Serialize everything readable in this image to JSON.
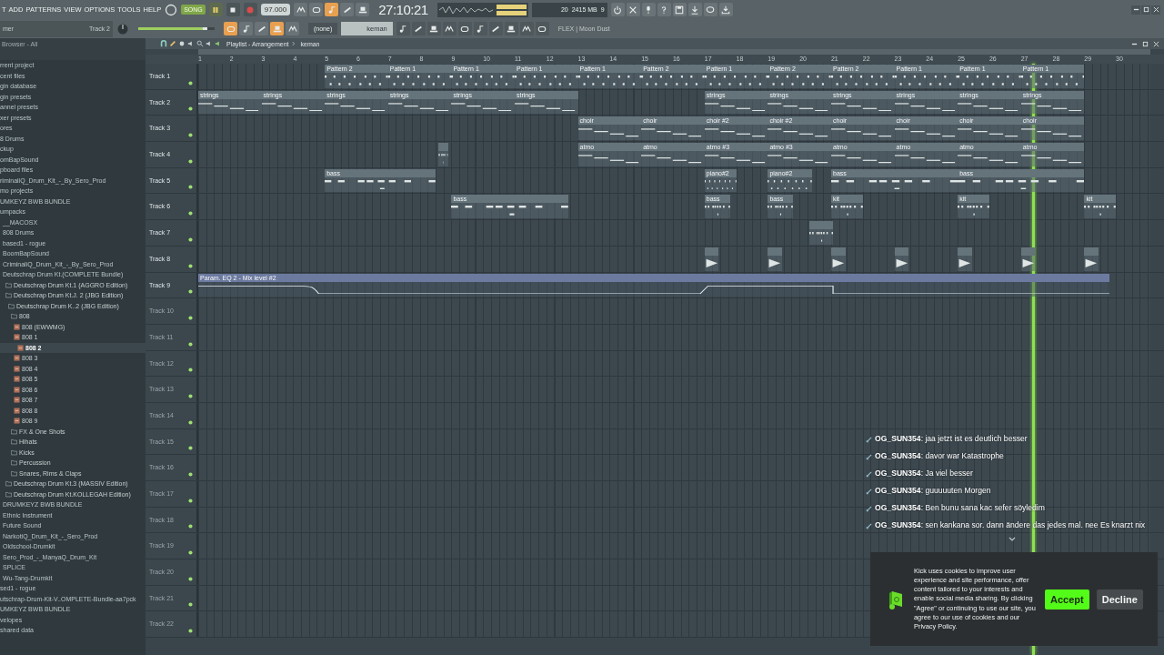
{
  "menu": [
    "T",
    "ADD",
    "PATTERNS",
    "VIEW",
    "OPTIONS",
    "TOOLS",
    "HELP"
  ],
  "hint_panel": {
    "title": "mer",
    "value": "Track 2"
  },
  "transport": {
    "song_mode": {
      "label": "SONG",
      "on": true
    },
    "tempo": "97.000",
    "time": "27:10:21",
    "memory": "2415 MB",
    "voices": "9",
    "cpu": "20"
  },
  "tool_buttons": [
    {
      "on": false
    },
    {
      "on": false
    },
    {
      "on": true
    },
    {
      "on": false
    },
    {
      "on": false
    }
  ],
  "master_volume": {
    "level": 0.9
  },
  "snap_buttons": [
    {
      "on": true
    },
    {
      "on": false
    },
    {
      "on": false
    },
    {
      "on": true
    },
    {
      "on": false
    }
  ],
  "channel_dropdown": "(none)",
  "pattern_selector": "keman",
  "hint_text": "FLEX | Moon Dust",
  "browser": {
    "title": "Browser - All",
    "items": [
      {
        "label": "rrent project",
        "kind": "category",
        "selected": false
      },
      {
        "label": "cent files",
        "kind": "category",
        "selected": false
      },
      {
        "label": "gin database",
        "kind": "category",
        "selected": false
      },
      {
        "label": "gin presets",
        "kind": "category",
        "selected": false
      },
      {
        "label": "annel presets",
        "kind": "category",
        "selected": false
      },
      {
        "label": "xer presets",
        "kind": "category",
        "selected": false
      },
      {
        "label": "ores",
        "kind": "category",
        "selected": false
      },
      {
        "label": "8 Drums",
        "kind": "category",
        "selected": false
      },
      {
        "label": "ckup",
        "kind": "category",
        "selected": false
      },
      {
        "label": "omBapSound",
        "kind": "category",
        "selected": false
      },
      {
        "label": "pboard files",
        "kind": "category",
        "selected": false
      },
      {
        "label": "riminaliQ_Drum_Kit_-_By_Sero_Prod",
        "kind": "category",
        "selected": false
      },
      {
        "label": "mo projects",
        "kind": "category",
        "selected": false
      },
      {
        "label": "UMKEYZ BWB BUNDLE",
        "kind": "category",
        "selected": false
      },
      {
        "label": "umpacks",
        "kind": "category",
        "selected": false,
        "children": [
          {
            "label": "__MACOSX",
            "kind": "category",
            "selected": false
          },
          {
            "label": "808 Drums",
            "kind": "category",
            "selected": false
          },
          {
            "label": "based1 - rogue",
            "kind": "category",
            "selected": false
          },
          {
            "label": "BoomBapSound",
            "kind": "category",
            "selected": false
          },
          {
            "label": "CriminaliQ_Drum_Kit_-_By_Sero_Prod",
            "kind": "category",
            "selected": false
          },
          {
            "label": "Deutschrap Drum Kt.(COMPLETE Bundle)",
            "kind": "category",
            "selected": false,
            "children": [
              {
                "label": "Deutschrap Drum Kt.1 (AGGRO Edition)",
                "kind": "folder",
                "selected": false
              },
              {
                "label": "Deutschrap Drum Kt.J. 2 (JBG Edition)",
                "kind": "folder",
                "selected": false,
                "children": [
                  {
                    "label": "Deutschrap Drum K..2 (JBG Edition)",
                    "kind": "folder",
                    "selected": false,
                    "children": [
                      {
                        "label": "808",
                        "kind": "folder",
                        "selected": false,
                        "children": [
                          {
                            "label": "808 (EWWMG)",
                            "kind": "sample",
                            "selected": false
                          },
                          {
                            "label": "808 1",
                            "kind": "sample",
                            "selected": false
                          },
                          {
                            "label": "808 2",
                            "kind": "sample",
                            "selected": true
                          },
                          {
                            "label": "808 3",
                            "kind": "sample",
                            "selected": false
                          },
                          {
                            "label": "808 4",
                            "kind": "sample",
                            "selected": false
                          },
                          {
                            "label": "808 5",
                            "kind": "sample",
                            "selected": false
                          },
                          {
                            "label": "808 6",
                            "kind": "sample",
                            "selected": false
                          },
                          {
                            "label": "808 7",
                            "kind": "sample",
                            "selected": false
                          },
                          {
                            "label": "808 8",
                            "kind": "sample",
                            "selected": false
                          },
                          {
                            "label": "808 9",
                            "kind": "sample",
                            "selected": false
                          }
                        ]
                      },
                      {
                        "label": "FX & One Shots",
                        "kind": "folder",
                        "selected": false
                      },
                      {
                        "label": "Hihats",
                        "kind": "folder",
                        "selected": false
                      },
                      {
                        "label": "Kicks",
                        "kind": "folder",
                        "selected": false
                      },
                      {
                        "label": "Percussion",
                        "kind": "folder",
                        "selected": false
                      },
                      {
                        "label": "Snares, Rims & Claps",
                        "kind": "folder",
                        "selected": false
                      }
                    ]
                  }
                ]
              },
              {
                "label": "Deutschrap Drum Kt.3 (MASSIV Edition)",
                "kind": "folder",
                "selected": false
              },
              {
                "label": "Deutschrap Drum Kt.KOLLEGAH Edition)",
                "kind": "folder",
                "selected": false
              }
            ]
          },
          {
            "label": "DRUMKEYZ BWB BUNDLE",
            "kind": "category",
            "selected": false
          },
          {
            "label": "Ethnic Instrument",
            "kind": "category",
            "selected": false
          },
          {
            "label": "Future Sound",
            "kind": "category",
            "selected": false
          },
          {
            "label": "NarkotiQ_Drum_Kit_-_Sero_Prod",
            "kind": "category",
            "selected": false
          },
          {
            "label": "Oldschool-Drumkit",
            "kind": "category",
            "selected": false
          },
          {
            "label": "Sero_Prod_-_ManyaQ_Drum_Kit",
            "kind": "category",
            "selected": false
          },
          {
            "label": "SPLICE",
            "kind": "category",
            "selected": false
          },
          {
            "label": "Wu-Tang-Drumkit",
            "kind": "category",
            "selected": false
          }
        ]
      },
      {
        "label": "sed1 - rogue",
        "kind": "category",
        "selected": false
      },
      {
        "label": "utschrap-Drum-Kit-V..OMPLETE-Bundle-aa7pck",
        "kind": "category",
        "selected": false
      },
      {
        "label": "UMKEYZ BWB BUNDLE",
        "kind": "category",
        "selected": false
      },
      {
        "label": "velopes",
        "kind": "category",
        "selected": false
      },
      {
        "label": "shared data",
        "kind": "category",
        "selected": false
      }
    ]
  },
  "playlist": {
    "breadcrumb": [
      "Playlist - Arrangement",
      "keman"
    ],
    "bars": [
      "1",
      "2",
      "3",
      "4",
      "5",
      "6",
      "7",
      "8",
      "9",
      "10",
      "11",
      "12",
      "13",
      "14",
      "15",
      "16",
      "17",
      "18",
      "19",
      "20",
      "21",
      "22",
      "23",
      "24",
      "25",
      "26",
      "27",
      "28",
      "29",
      "30"
    ],
    "playhead": {
      "level": 0.876
    },
    "tracks": [
      {
        "name": "Track 1",
        "clips": [
          {
            "label": "Pattern 2",
            "kind": "dots"
          },
          {
            "label": "Pattern 1",
            "kind": "dots"
          },
          {
            "label": "Pattern 1",
            "kind": "dots"
          },
          {
            "label": "Pattern 1",
            "kind": "dots"
          },
          {
            "label": "Pattern 1",
            "kind": "dots"
          },
          {
            "label": "Pattern 2",
            "kind": "dots"
          },
          {
            "label": "Pattern 1",
            "kind": "dots"
          },
          {
            "label": "Pattern 2",
            "kind": "dots"
          },
          {
            "label": "Pattern 2",
            "kind": "dots"
          },
          {
            "label": "Pattern 1",
            "kind": "dots"
          },
          {
            "label": "Pattern 1",
            "kind": "dots"
          },
          {
            "label": "Pattern 1",
            "kind": "dots"
          }
        ]
      },
      {
        "name": "Track 2",
        "clips": [
          {
            "label": "strings",
            "kind": "steps"
          },
          {
            "label": "strings",
            "kind": "steps"
          },
          {
            "label": "strings",
            "kind": "steps"
          },
          {
            "label": "strings",
            "kind": "steps"
          },
          {
            "label": "strings",
            "kind": "steps"
          },
          {
            "label": "strings",
            "kind": "steps"
          },
          {
            "label": "strings",
            "kind": "steps"
          },
          {
            "label": "strings",
            "kind": "steps"
          },
          {
            "label": "strings",
            "kind": "steps"
          },
          {
            "label": "strings",
            "kind": "steps"
          },
          {
            "label": "strings",
            "kind": "steps"
          },
          {
            "label": "strings",
            "kind": "steps"
          }
        ]
      },
      {
        "name": "Track 3",
        "clips": [
          {
            "label": "choir",
            "kind": "steps"
          },
          {
            "label": "choir",
            "kind": "steps"
          },
          {
            "label": "choir #2",
            "kind": "steps"
          },
          {
            "label": "choir #2",
            "kind": "steps"
          },
          {
            "label": "choir",
            "kind": "steps"
          },
          {
            "label": "choir",
            "kind": "steps"
          },
          {
            "label": "choir",
            "kind": "steps"
          },
          {
            "label": "choir",
            "kind": "steps"
          }
        ]
      },
      {
        "name": "Track 4",
        "clips": [
          {
            "kind": "dashes"
          },
          {
            "label": "atmo",
            "kind": "steps"
          },
          {
            "label": "atmo",
            "kind": "steps"
          },
          {
            "label": "atmo #3",
            "kind": "steps"
          },
          {
            "label": "atmo #3",
            "kind": "steps"
          },
          {
            "label": "atmo",
            "kind": "steps"
          },
          {
            "label": "atmo",
            "kind": "steps"
          },
          {
            "label": "atmo",
            "kind": "steps"
          },
          {
            "label": "atmo",
            "kind": "steps"
          }
        ]
      },
      {
        "name": "Track 5",
        "clips": [
          {
            "label": "bass",
            "kind": "dashes"
          },
          {
            "label": "piano#2",
            "kind": "dots"
          },
          {
            "label": "piano#2",
            "kind": "dots"
          },
          {
            "label": "bass",
            "kind": "dashes"
          },
          {
            "label": "bass",
            "kind": "dashes"
          }
        ]
      },
      {
        "name": "Track 6",
        "clips": [
          {
            "label": "bass",
            "kind": "dashes"
          },
          {
            "label": "bass",
            "kind": "dashes"
          },
          {
            "label": "bass",
            "kind": "dashes"
          },
          {
            "label": "kit",
            "kind": "dashes"
          },
          {
            "label": "kit",
            "kind": "dashes"
          },
          {
            "label": "kit",
            "kind": "dashes"
          }
        ]
      },
      {
        "name": "Track 7",
        "clips": [
          {
            "kind": "dashes"
          }
        ]
      },
      {
        "name": "Track 8",
        "clips": [
          {
            "kind": "kick"
          },
          {
            "kind": "kick"
          },
          {
            "kind": "kick"
          },
          {
            "kind": "kick"
          },
          {
            "kind": "kick"
          },
          {
            "kind": "kick"
          },
          {
            "kind": "kick"
          }
        ]
      },
      {
        "name": "Track 9",
        "clips": [
          {
            "label": "Param. EQ 2 - Mix level #2",
            "kind": "automation"
          }
        ]
      },
      {
        "name": "Track 10"
      },
      {
        "name": "Track 11"
      },
      {
        "name": "Track 12"
      },
      {
        "name": "Track 13"
      },
      {
        "name": "Track 14"
      },
      {
        "name": "Track 15"
      },
      {
        "name": "Track 16"
      },
      {
        "name": "Track 17"
      },
      {
        "name": "Track 18"
      },
      {
        "name": "Track 19"
      },
      {
        "name": "Track 20"
      },
      {
        "name": "Track 21"
      },
      {
        "name": "Track 22"
      }
    ]
  },
  "chat": {
    "messages": [
      {
        "text": "**OG_SUN354**: jaa jetzt ist es deutlich besser"
      },
      {
        "text": "**OG_SUN354**: davor war Katastrophe"
      },
      {
        "text": "**OG_SUN354**: Ja viel besser"
      },
      {
        "text": "**OG_SUN354**: guuuuuten Morgen"
      },
      {
        "text": "**OG_SUN354**: Ben bunu sana kac sefer söyledim"
      },
      {
        "text": "**OG_SUN354**: sen kankana sor. dann ändere das jedes mal. nee Es knarzt nix"
      }
    ]
  },
  "cookie_banner": {
    "text": "Kick uses cookies to improve user experience and site performance, offer content tailored to your interests and enable social media sharing. By clicking \"Agree\" or continuing to use our site, you agree to our use of cookies and our Privacy Policy.",
    "buttons": [
      {
        "label": "Accept",
        "kind": "primary"
      },
      {
        "label": "Decline",
        "kind": "secondary"
      }
    ]
  }
}
